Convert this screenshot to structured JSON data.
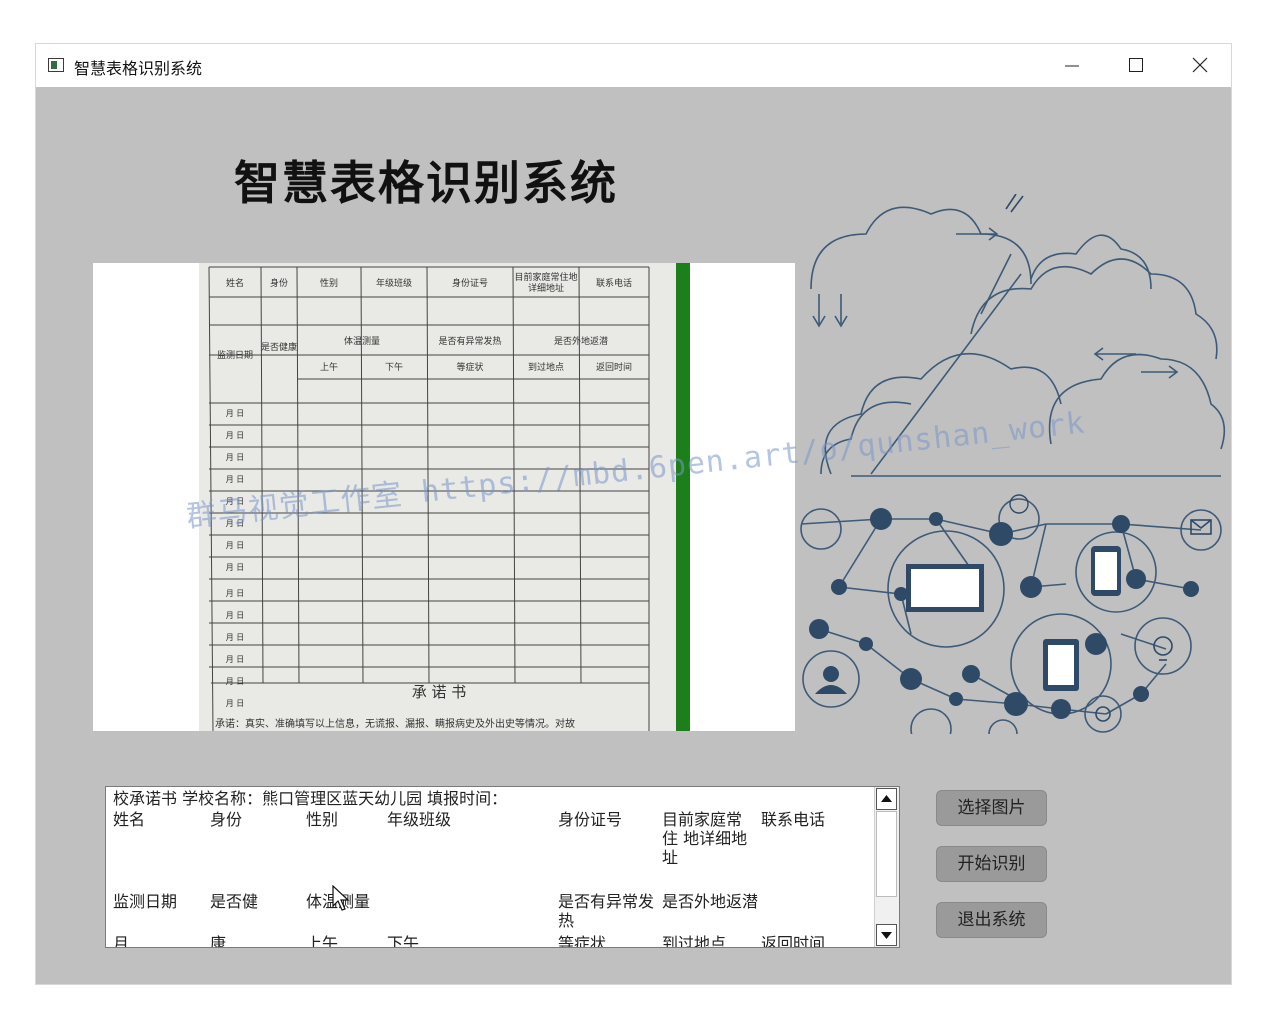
{
  "window": {
    "title": "智慧表格识别系统",
    "controls": {
      "minimize": "minimize-icon",
      "maximize": "maximize-icon",
      "close": "close-icon"
    }
  },
  "main": {
    "heading": "智慧表格识别系统",
    "watermark": "群马视觉工作室 https://mbd.6pen.art/o/qunshan_work"
  },
  "form_image": {
    "header_row": [
      "姓名",
      "身份",
      "性别",
      "年级班级",
      "身份证号",
      "目前家庭常住地详细地址",
      "联系电话"
    ],
    "group_row": [
      "监测日期",
      "是否健康",
      "体温测量",
      "是否有异常发热",
      "是否外地返潜"
    ],
    "sub_row": [
      "上午",
      "下午",
      "等症状",
      "到过地点",
      "返回时间"
    ],
    "date_rows": [
      "月 日",
      "月 日",
      "月 日",
      "月 日",
      "月 日",
      "月 日",
      "月 日",
      "月 日",
      "月 日",
      "月 日",
      "月 日",
      "月 日",
      "月 日",
      "月 日"
    ],
    "pledge_title": "承 诺 书",
    "pledge_text": "承诺：真实、准确填写以上信息，无谎报、漏报、瞒报病史及外出史等情况。对故"
  },
  "result_text": {
    "lines": [
      {
        "cells": [
          "校承诺书 学校名称：熊口管理区蓝天幼儿园 填报时间："
        ]
      },
      {
        "cells": [
          "姓名",
          "身份",
          "性别",
          "年级班级",
          "身份证号",
          "目前家庭常",
          "联系电话"
        ]
      },
      {
        "cells": [
          "住 地详细地"
        ]
      },
      {
        "cells": [
          "址"
        ]
      },
      {
        "cells": [
          "监测日期",
          "是否健",
          "体温测量",
          "是否有异常发",
          "是否外地返潜"
        ]
      },
      {
        "cells": [
          "热"
        ]
      },
      {
        "cells": [
          "月",
          "康",
          "上午",
          "下午",
          "等症状",
          "到过地点",
          "返回时间"
        ]
      }
    ]
  },
  "buttons": {
    "select_image": "选择图片",
    "start_recognition": "开始识别",
    "exit_system": "退出系统"
  },
  "colors": {
    "window_bg": "#c0c0c0",
    "button_bg": "#9a9a9a",
    "accent_green": "#1c7f1c",
    "illustration": "#2f4a66"
  }
}
